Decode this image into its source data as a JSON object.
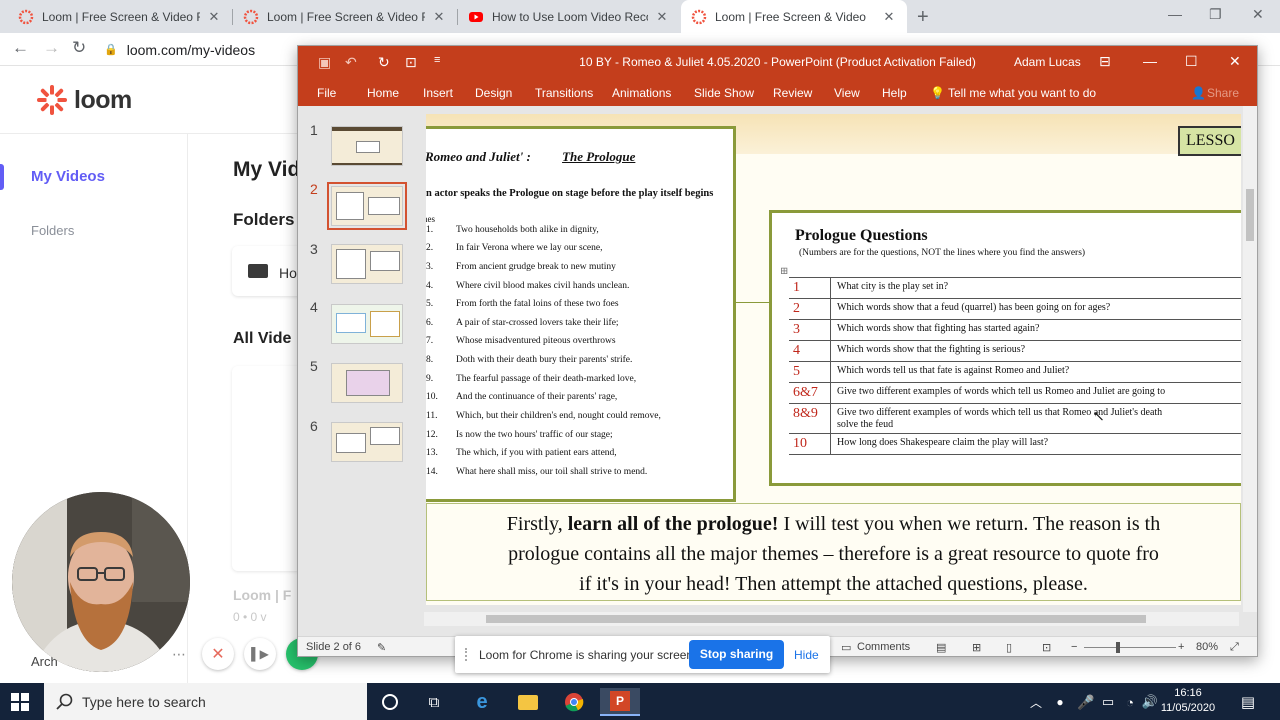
{
  "browser": {
    "tabs": [
      {
        "title": "Loom | Free Screen & Video Recording",
        "favicon": "loom-icon",
        "active": false
      },
      {
        "title": "Loom | Free Screen & Video Recording",
        "favicon": "loom-icon",
        "active": false
      },
      {
        "title": "How to Use Loom Video Recorder",
        "favicon": "youtube-icon",
        "active": false
      },
      {
        "title": "Loom | Free Screen & Video",
        "favicon": "loom-icon",
        "active": true
      }
    ],
    "url": "loom.com/my-videos",
    "colors": {
      "tabstrip": "#dee1e6",
      "loom_accent": "#625df5",
      "loom_logo": "#f0533f"
    }
  },
  "loom": {
    "logo_text": "loom",
    "nav": {
      "my_videos": "My Videos",
      "folders": "Folders"
    },
    "page_title": "My Vid",
    "folders_heading": "Folders",
    "folder_name": "Ho",
    "all_videos_heading": "All Vide",
    "video_card": {
      "title": "Loom | F",
      "meta": "0 • 0 v"
    },
    "archive": "Arch"
  },
  "powerpoint": {
    "window_title": "10 BY - Romeo & Juliet 4.05.2020  -  PowerPoint (Product Activation Failed)",
    "user": "Adam Lucas",
    "ribbon": [
      "File",
      "Home",
      "Insert",
      "Design",
      "Transitions",
      "Animations",
      "Slide Show",
      "Review",
      "View",
      "Help"
    ],
    "tell_me": "Tell me what you want to do",
    "share": "Share",
    "thumbnails": [
      "1",
      "2",
      "3",
      "4",
      "5",
      "6"
    ],
    "selected_slide": 2,
    "status": {
      "slide": "Slide 2 of 6",
      "comments": "Comments",
      "zoom": "80%"
    },
    "colors": {
      "titlebar": "#c43e1c",
      "box_border": "#8a9a3a",
      "question_number": "#c0271b"
    }
  },
  "slide": {
    "lesson_label": "LESSO",
    "prologue_title_left": "Romeo and Juliet' :",
    "prologue_title_right": "The Prologue",
    "prologue_subtitle": "n actor speaks the Prologue on stage before the play itself begins",
    "lines_label": "nes",
    "lines": [
      {
        "n": "1.",
        "text": "Two households both alike in dignity,"
      },
      {
        "n": "2.",
        "text": "In fair Verona where we lay our scene,"
      },
      {
        "n": "3.",
        "text": "From ancient grudge break to new mutiny"
      },
      {
        "n": "4.",
        "text": "Where civil blood makes civil hands unclean."
      },
      {
        "n": "5.",
        "text": "From forth the fatal loins of these two foes"
      },
      {
        "n": "6.",
        "text": "A pair of star-crossed lovers take their life;"
      },
      {
        "n": "7.",
        "text": "Whose misadventured piteous overthrows"
      },
      {
        "n": "8.",
        "text": "Doth with their death bury their parents' strife."
      },
      {
        "n": "9.",
        "text": "The fearful passage of their death-marked love,"
      },
      {
        "n": "10.",
        "text": "And the continuance of their parents' rage,"
      },
      {
        "n": "11.",
        "text": "Which, but their children's end, nought could remove,"
      },
      {
        "n": "12.",
        "text": "Is now the two hours' traffic of our stage;"
      },
      {
        "n": "13.",
        "text": "The which, if you with patient ears attend,"
      },
      {
        "n": "14.",
        "text": "What here shall miss, our toil shall strive to mend."
      }
    ],
    "questions_title": "Prologue Questions",
    "questions_subtitle": "(Numbers are for the questions, NOT the lines where you find the answers)",
    "questions": [
      {
        "n": "1",
        "text": "What city is the play set in?"
      },
      {
        "n": "2",
        "text": "Which words show that a feud (quarrel) has been going on for ages?"
      },
      {
        "n": "3",
        "text": "Which words show that fighting has started again?"
      },
      {
        "n": "4",
        "text": "Which words show that the fighting is serious?"
      },
      {
        "n": "5",
        "text": "Which words tell us that fate is against Romeo and Juliet?"
      },
      {
        "n": "6&7",
        "text": "Give two different examples of words which tell us Romeo and Juliet are going to"
      },
      {
        "n": "8&9",
        "text": "Give two different examples of words which tell us that Romeo and Juliet's death",
        "text2": "solve the feud"
      },
      {
        "n": "10",
        "text": "How long does Shakespeare claim the play will last?"
      }
    ],
    "note_line1_a": "Firstly, ",
    "note_line1_b": "learn all of the prologue!",
    "note_line1_c": " I will test you when we return. The reason is th",
    "note_line2": "prologue contains all the major themes – therefore is a great resource to quote fro",
    "note_line3": "if it's in your head! Then attempt the attached questions, please."
  },
  "share_bar": {
    "message": "Loom for Chrome is sharing your screen.",
    "stop": "Stop sharing",
    "hide": "Hide"
  },
  "taskbar": {
    "search_placeholder": "Type here to search",
    "time": "16:16",
    "date": "11/05/2020"
  }
}
